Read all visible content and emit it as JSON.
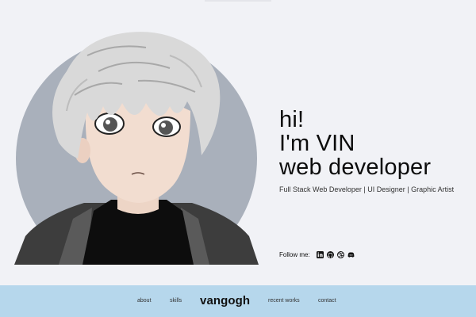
{
  "intro": {
    "greeting": "hi!",
    "name_line": "I'm VIN",
    "role_line": "web developer",
    "subtitle": "Full Stack Web Developer | UI Designer | Graphic Artist"
  },
  "social": {
    "label": "Follow me:",
    "icons": [
      "linkedin-icon",
      "github-icon",
      "dribbble-icon",
      "discord-icon"
    ]
  },
  "footer": {
    "links": {
      "about": "about",
      "skills": "skills",
      "recent_works": "recent works",
      "contact": "contact"
    },
    "brand": "vangogh"
  },
  "colors": {
    "background": "#f1f2f6",
    "footer": "#b6d7ec",
    "circle": "#a9b0bb",
    "text": "#111111"
  }
}
